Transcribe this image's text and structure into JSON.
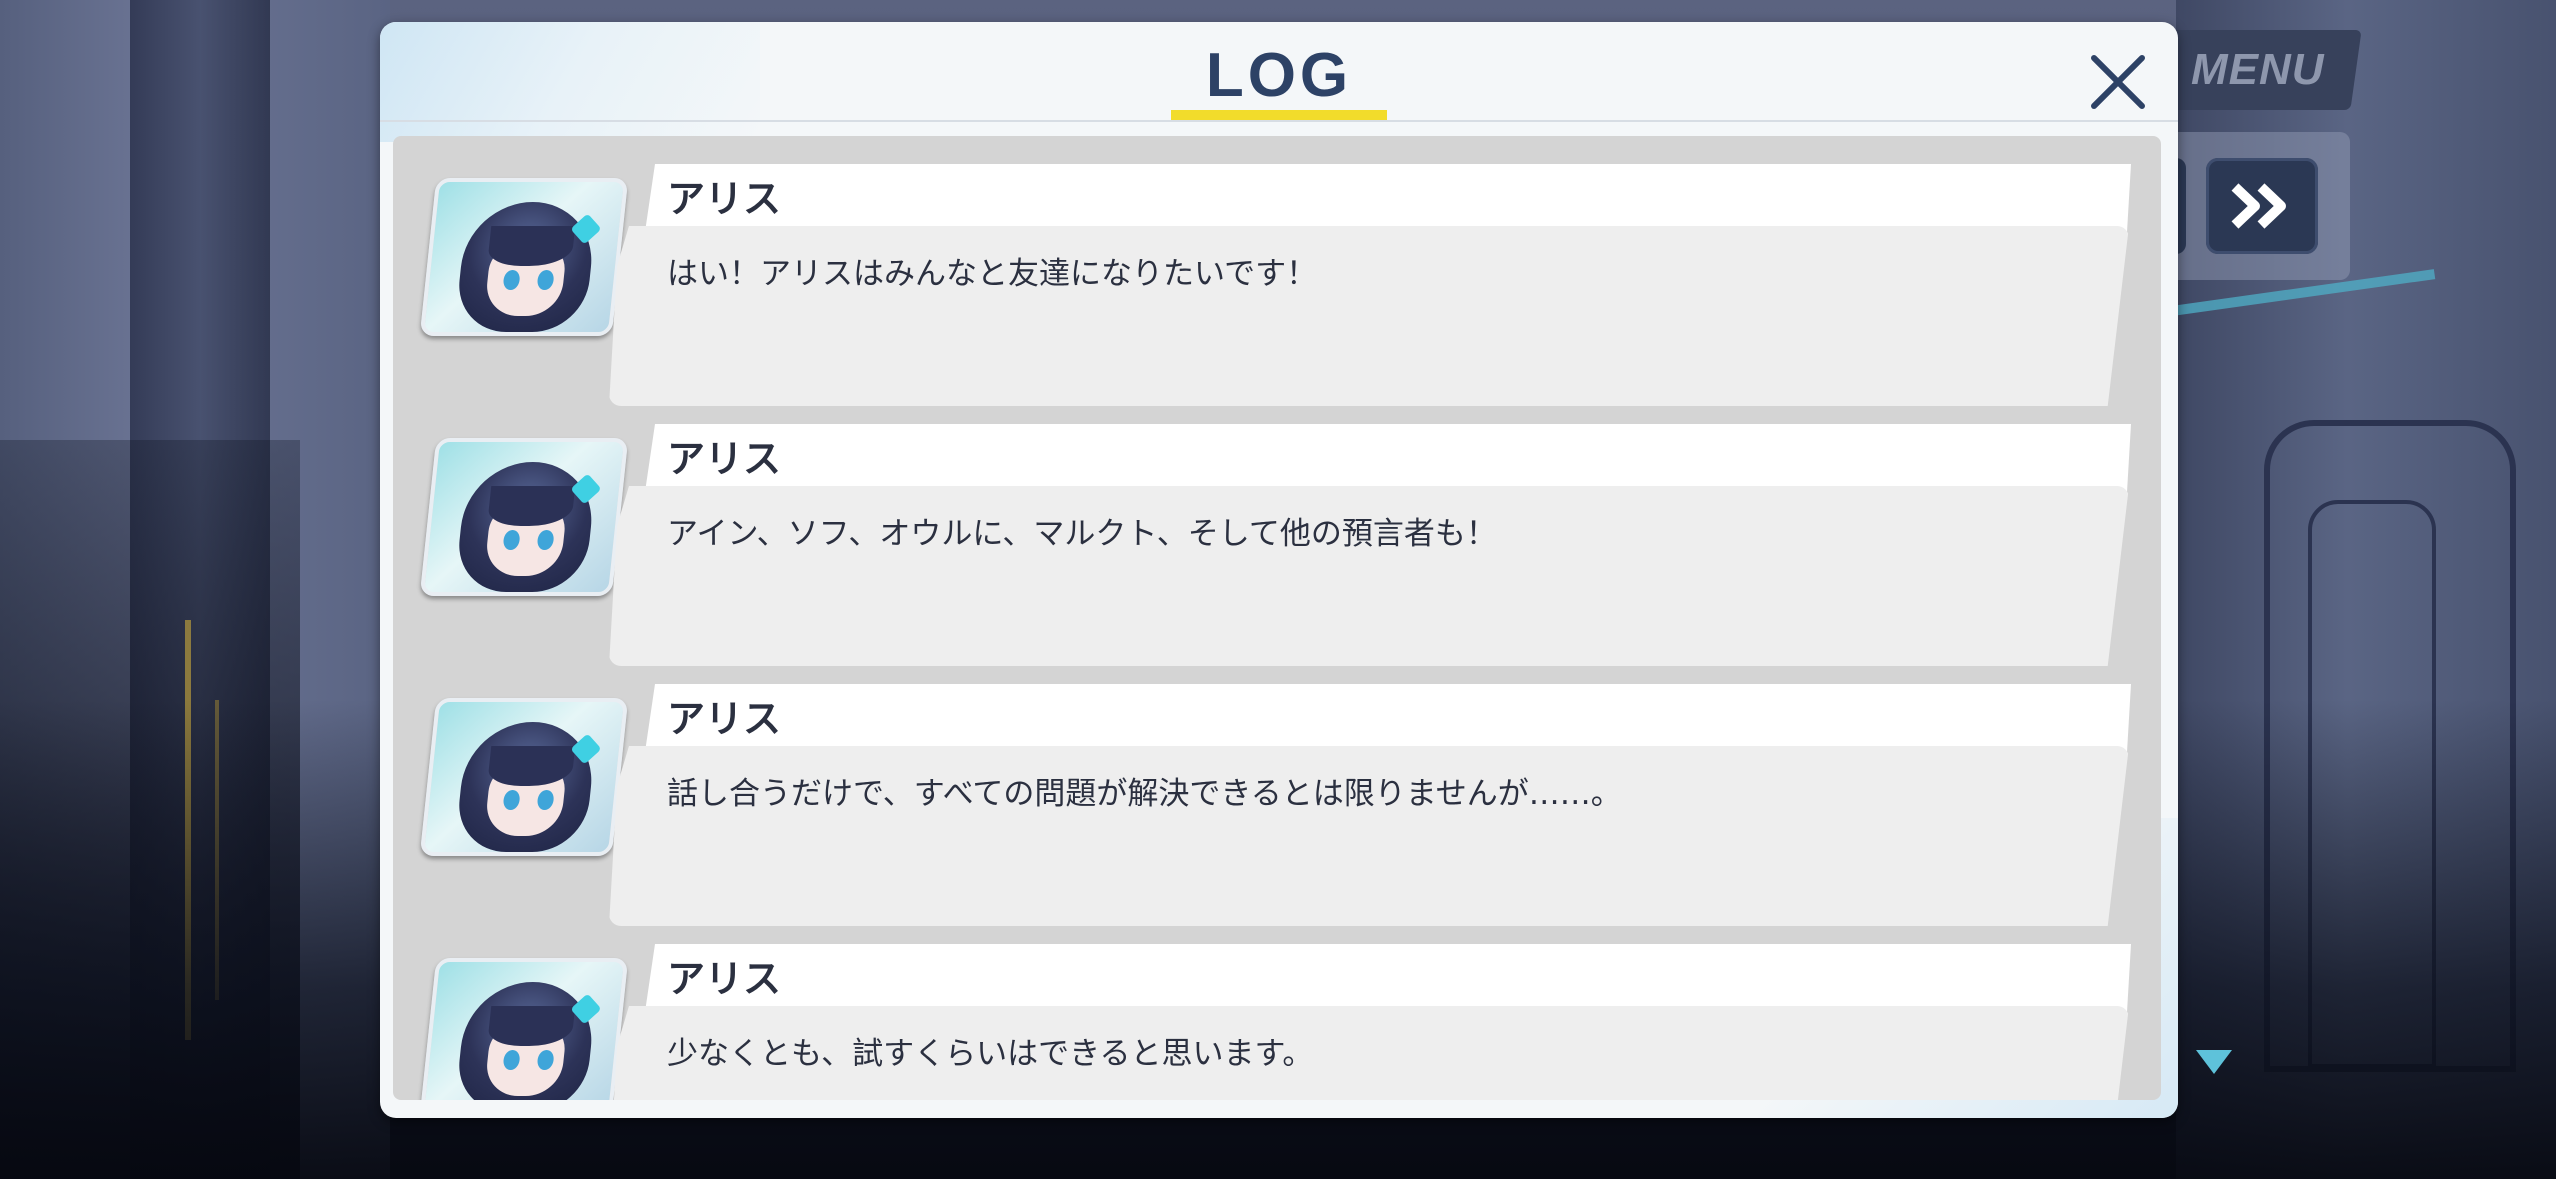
{
  "hud": {
    "menu_label": "MENU",
    "fast_forward_icon": "fast-forward-icon",
    "next_indicator_icon": "triangle-down-icon"
  },
  "log": {
    "title": "LOG",
    "close_icon": "close-icon",
    "accent_color": "#f2dc2b",
    "title_color": "#2d4266",
    "entries": [
      {
        "speaker": "アリス",
        "text": "はい！アリスはみんなと友達になりたいです！"
      },
      {
        "speaker": "アリス",
        "text": "アイン、ソフ、オウルに、マルクト、そして他の預言者も！"
      },
      {
        "speaker": "アリス",
        "text": "話し合うだけで、すべての問題が解決できるとは限りませんが……。"
      },
      {
        "speaker": "アリス",
        "text": "少なくとも、試すくらいはできると思います。"
      }
    ]
  }
}
